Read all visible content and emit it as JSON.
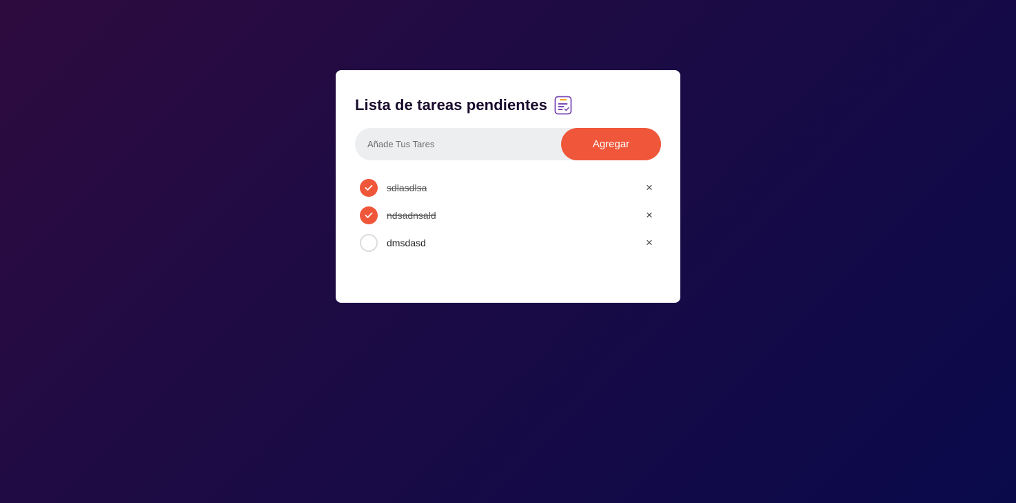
{
  "app": {
    "title": "Lista de tareas pendientes",
    "title_icon": "checklist-icon"
  },
  "form": {
    "input_value": "",
    "placeholder": "Añade Tus Tares",
    "add_label": "Agregar"
  },
  "tasks": [
    {
      "text": "sdlasdlsa",
      "completed": true
    },
    {
      "text": "ndsadnsald",
      "completed": true
    },
    {
      "text": "dmsdasd",
      "completed": false
    }
  ],
  "icons": {
    "check": "check-icon",
    "remove": "close-icon",
    "remove_glyph": "×"
  },
  "colors": {
    "accent": "#f0573a",
    "background_start": "#2e0b3f",
    "background_end": "#0a0a4a",
    "card": "#ffffff",
    "title": "#1a0b2e"
  }
}
